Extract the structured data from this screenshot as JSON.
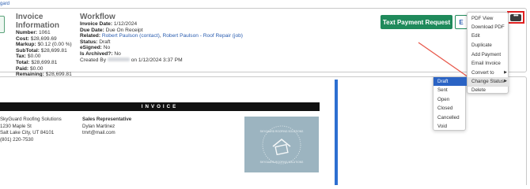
{
  "breadcrumb": "gard",
  "invoice_info": {
    "title": "Invoice Information",
    "lines": [
      {
        "label": "Number:",
        "value": "1061"
      },
      {
        "label": "Cost:",
        "value": "$28,699.69"
      },
      {
        "label": "Markup:",
        "value": "$0.12 (0.00 %)"
      },
      {
        "label": "SubTotal:",
        "value": "$28,699.81"
      },
      {
        "label": "Tax:",
        "value": "$0.00"
      },
      {
        "label": "Total:",
        "value": "$28,699.81"
      },
      {
        "label": "Paid:",
        "value": "$0.00"
      },
      {
        "label": "Remaining:",
        "value": "$28,699.81"
      },
      {
        "label": "Pages:",
        "value": "2"
      }
    ]
  },
  "workflow": {
    "title": "Workflow",
    "invoice_date_label": "Invoice Date:",
    "invoice_date": "1/12/2024",
    "due_date_label": "Due Date:",
    "due_date": "Due On Receipt",
    "related_label": "Related:",
    "related_contact": "Robert Paulson (contact)",
    "related_sep": ", ",
    "related_job": "Robert Paulson - Roof Repair (job)",
    "status_label": "Status:",
    "status": "Draft",
    "esigned_label": "eSigned:",
    "esigned": "No",
    "archived_label": "Is Archived?:",
    "archived": "No",
    "created_prefix": "Created By",
    "created_suffix": "on 1/12/2024 3:37 PM"
  },
  "buttons": {
    "text_payment": "Text Payment Request",
    "e_short": "E",
    "more_label": "•••"
  },
  "menu": {
    "items": [
      "PDF View",
      "Download PDF",
      "Edit",
      "Duplicate",
      "Add Payment",
      "Email Invoice",
      "Convert to",
      "Change Status",
      "Delete"
    ],
    "submenu_arrow": "▶"
  },
  "submenu": {
    "items": [
      "Draft",
      "Sent",
      "Open",
      "Closed",
      "Cancelled",
      "Void"
    ]
  },
  "document": {
    "heading": "INVOICE",
    "company_lines": [
      "SkyGuard Roofing Solutions",
      "1230 Maple St",
      "Salt Lake City, UT 84101",
      "(801) 220-7530"
    ],
    "rep_heading": "Sales Representative",
    "rep_lines": [
      "Dylan Martinez",
      "tmrt@mail.com"
    ],
    "logo_text_top": "SKYGUARD ROOFING SOLUTIONS",
    "logo_text_bottom": "SKYGUARD ROOFING SOLUTIONS"
  },
  "colors": {
    "accent_green": "#1f8a5b",
    "accent_blue": "#2a63c4",
    "highlight_red": "#e02020",
    "arrow_red": "#e8584a"
  }
}
